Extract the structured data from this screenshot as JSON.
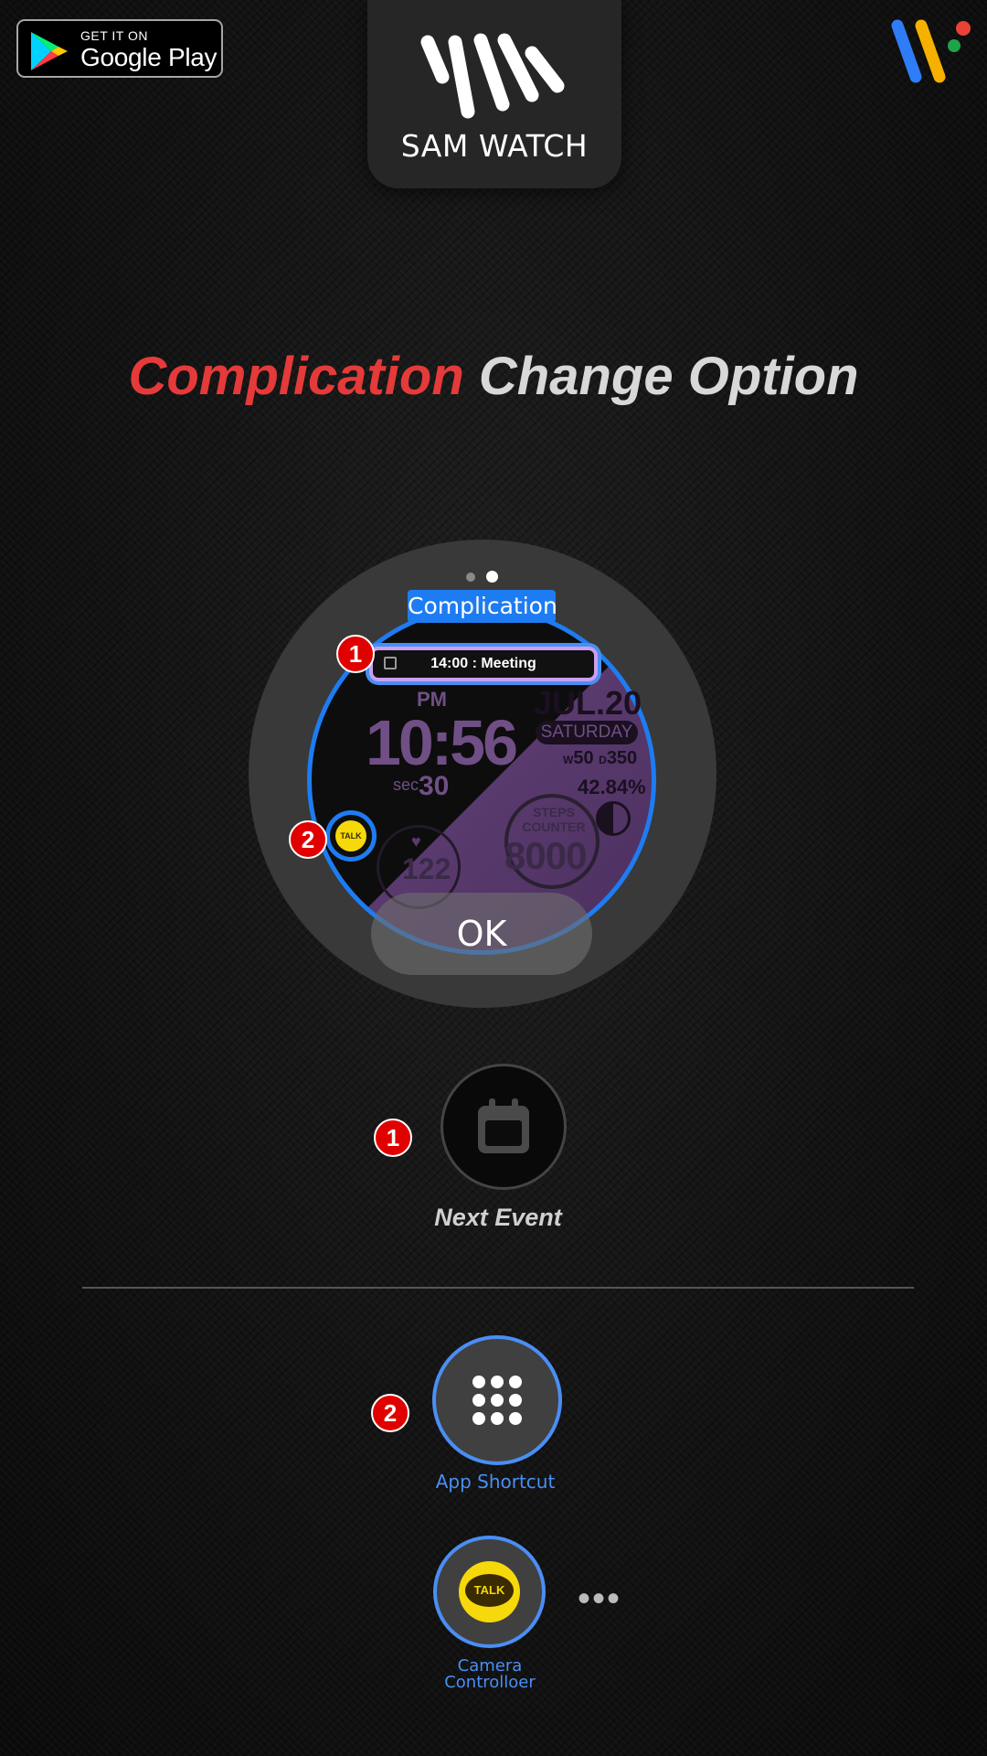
{
  "store_badge": {
    "line1": "GET IT ON",
    "line2": "Google Play"
  },
  "brand": {
    "name": "SAM WATCH"
  },
  "headline": {
    "part1": "Complication",
    "part2": "Change Option"
  },
  "preview": {
    "complication_tag": "Complication",
    "event_text": "14:00 : Meeting",
    "ampm": "PM",
    "time": "10:56",
    "sec_label": "sec",
    "seconds": "30",
    "date": "JUL.20",
    "day": "SATURDAY",
    "w_label": "W",
    "w_value": "50",
    "d_label": "D",
    "d_value": "350",
    "battery": "42.84%",
    "steps_label": "STEPS COUNTER",
    "steps": "8000",
    "heart_rate": "122",
    "talk_small": "TALK",
    "page_dots": 2,
    "active_dot": 2,
    "ok_label": "OK"
  },
  "badges": {
    "one": "1",
    "two": "2"
  },
  "next_event": {
    "label": "Next Event",
    "icon": "calendar-icon"
  },
  "app_shortcut": {
    "label": "App Shortcut",
    "icon": "grid-icon"
  },
  "camera": {
    "line1": "Camera",
    "line2": "Controlloer",
    "talk": "TALK",
    "more": "•••"
  },
  "colors": {
    "accent": "#1e7cf2",
    "headline_red": "#e53a3a",
    "badge_red": "#e10000",
    "talk_yellow": "#f5d90a"
  }
}
